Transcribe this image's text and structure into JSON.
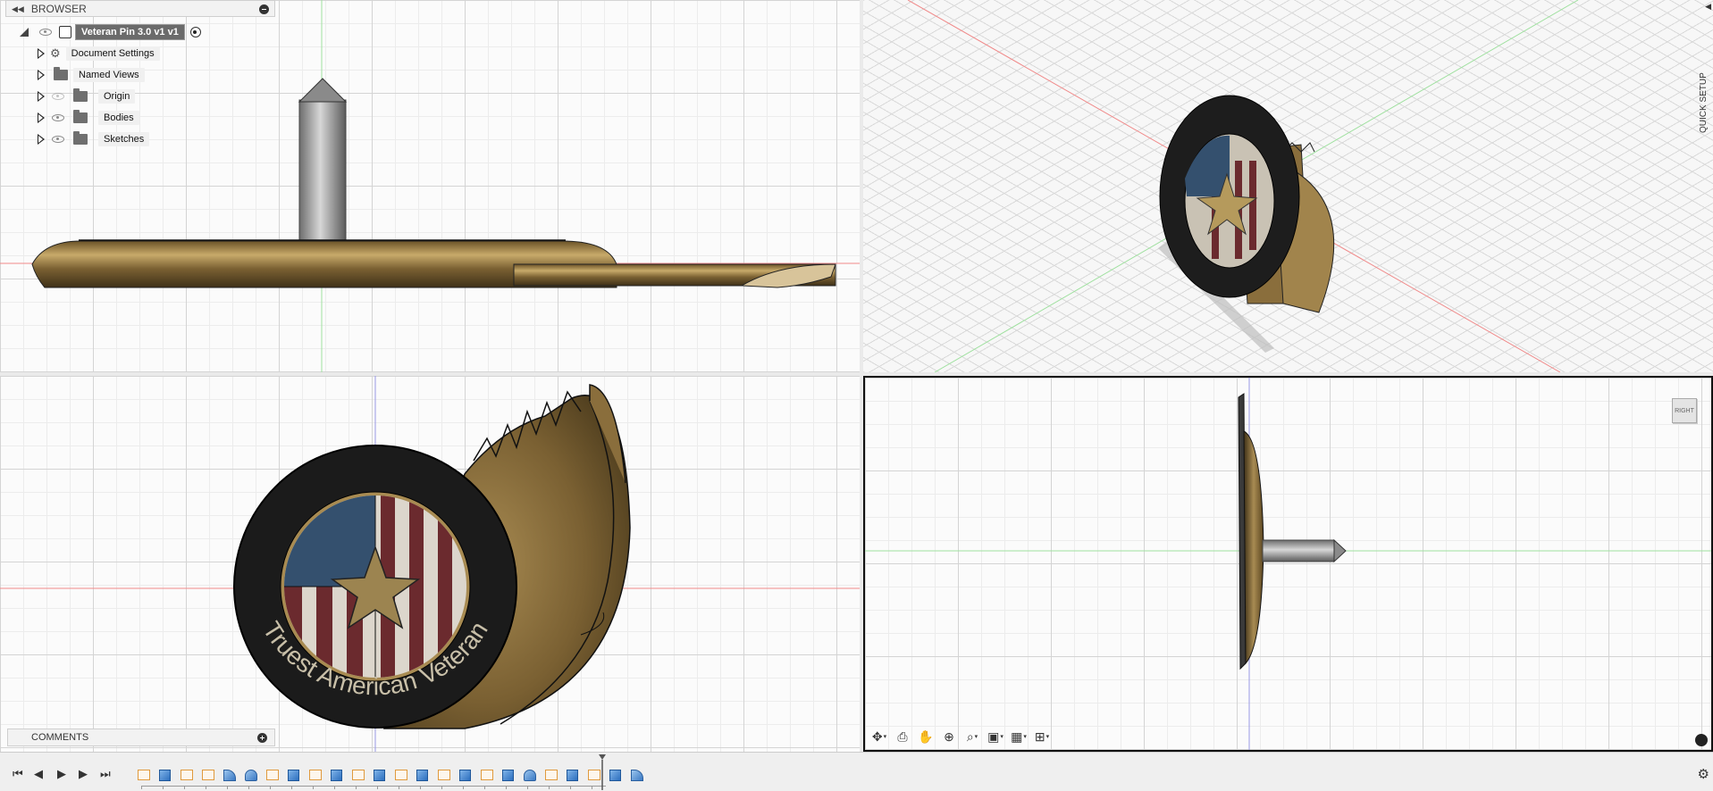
{
  "browser": {
    "title": "BROWSER",
    "root_label": "Veteran Pin 3.0 v1 v1",
    "items": [
      {
        "label": "Document Settings",
        "icon": "gear-icon"
      },
      {
        "label": "Named Views",
        "icon": "folder-icon"
      },
      {
        "label": "Origin",
        "icon": "folder-icon",
        "visibility": "hidden"
      },
      {
        "label": "Bodies",
        "icon": "folder-icon",
        "visibility": "visible"
      },
      {
        "label": "Sketches",
        "icon": "folder-icon",
        "visibility": "visible"
      }
    ]
  },
  "comments": {
    "title": "COMMENTS"
  },
  "quick_setup": {
    "label": "QUICK SETUP"
  },
  "viewcube": {
    "label": "RIGHT"
  },
  "pin": {
    "text": "Truest American Veteran"
  },
  "navbar": {
    "tools": [
      "orbit-icon",
      "look-at-icon",
      "pan-icon",
      "zoom-icon",
      "fit-icon",
      "display-settings-icon",
      "grid-settings-icon",
      "viewports-icon"
    ]
  },
  "timeline": {
    "controls": [
      "skip-to-start-icon",
      "step-back-icon",
      "play-icon",
      "step-forward-icon",
      "skip-to-end-icon"
    ],
    "features": [
      "sketch",
      "extrude",
      "sketch",
      "sketch",
      "fillet",
      "revolve",
      "sketch",
      "extrude",
      "sketch",
      "extrude",
      "sketch",
      "extrude",
      "sketch",
      "extrude",
      "sketch",
      "extrude",
      "sketch",
      "extrude",
      "revolve",
      "sketch",
      "extrude",
      "sketch",
      "extrude",
      "fillet"
    ]
  },
  "colors": {
    "bronze": "#8a6e3c",
    "bronze_light": "#b89a5c",
    "ring": "#1b1b1b",
    "flag_blue": "#34506e",
    "flag_red": "#6b2a2e",
    "flag_white": "#dcd6cc",
    "axis_red": "#e06060",
    "axis_green": "#7fd27f",
    "axis_blue": "#8080e0"
  }
}
